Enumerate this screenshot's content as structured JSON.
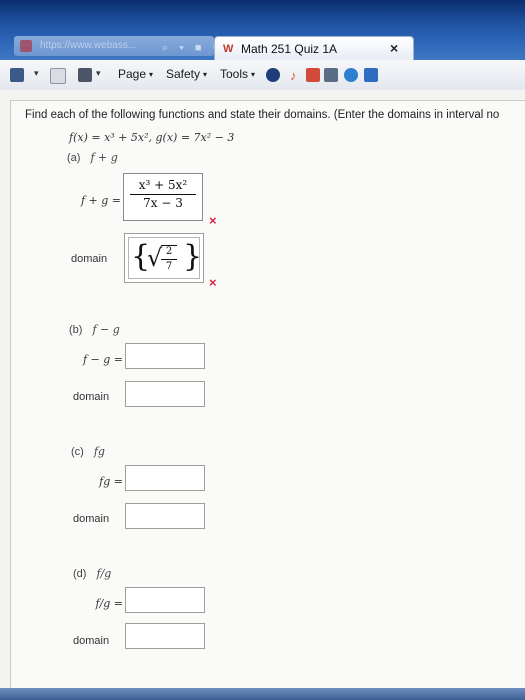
{
  "browser": {
    "address": "https://www.webass...",
    "tab_title": "Math 251 Quiz 1A",
    "tab_close": "×",
    "commands": [
      {
        "label": "Page",
        "arrow": "▾"
      },
      {
        "label": "Safety",
        "arrow": "▾"
      },
      {
        "label": "Tools",
        "arrow": "▾"
      }
    ]
  },
  "question": {
    "instructions": "Find each of the following functions and state their domains. (Enter the domains in interval no",
    "given": "f(x) = x³ + 5x²,   g(x) = 7x² − 3",
    "parts": [
      {
        "id": "a",
        "label": "(a)",
        "expr": "f + g",
        "result_label": "f + g =",
        "answer_num": "x³ + 5x²",
        "answer_den": "7x − 3",
        "answer_mark": "×",
        "domain_label": "domain",
        "domain_num": "2",
        "domain_den": "7",
        "domain_mark": "×"
      },
      {
        "id": "b",
        "label": "(b)",
        "expr": "f − g",
        "result_label": "f − g =",
        "domain_label": "domain"
      },
      {
        "id": "c",
        "label": "(c)",
        "expr": "fg",
        "result_label": "fg =",
        "domain_label": "domain"
      },
      {
        "id": "d",
        "label": "(d)",
        "expr": "f/g",
        "result_label": "f/g =",
        "domain_label": "domain"
      }
    ]
  },
  "colors": {
    "incorrect": "#e0263a",
    "titlebar": "#1d4f9e"
  }
}
